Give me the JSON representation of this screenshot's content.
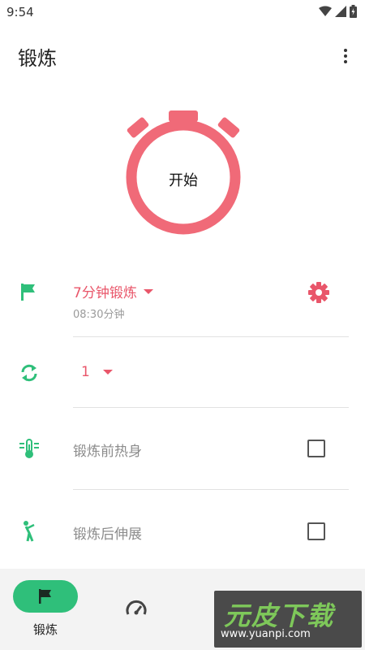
{
  "status": {
    "time": "9:54"
  },
  "app": {
    "title": "锻炼"
  },
  "stopwatch": {
    "label": "开始",
    "color": "#f06a78"
  },
  "workout": {
    "name": "7分钟锻炼",
    "duration": "08:30分钟"
  },
  "repeat": {
    "value": "1"
  },
  "options": [
    {
      "label": "锻炼前热身",
      "checked": false
    },
    {
      "label": "锻炼后伸展",
      "checked": false
    }
  ],
  "bottom_nav": {
    "active_label": "锻炼"
  },
  "watermark": {
    "main": "元皮下载",
    "url": "www.yuanpi.com"
  },
  "colors": {
    "accent": "#e9566a",
    "green": "#2fbf7a"
  },
  "icons": [
    "flag-icon",
    "repeat-icon",
    "thermometer-icon",
    "stretch-icon",
    "gear-icon",
    "speedometer-icon",
    "more-vert-icon"
  ]
}
